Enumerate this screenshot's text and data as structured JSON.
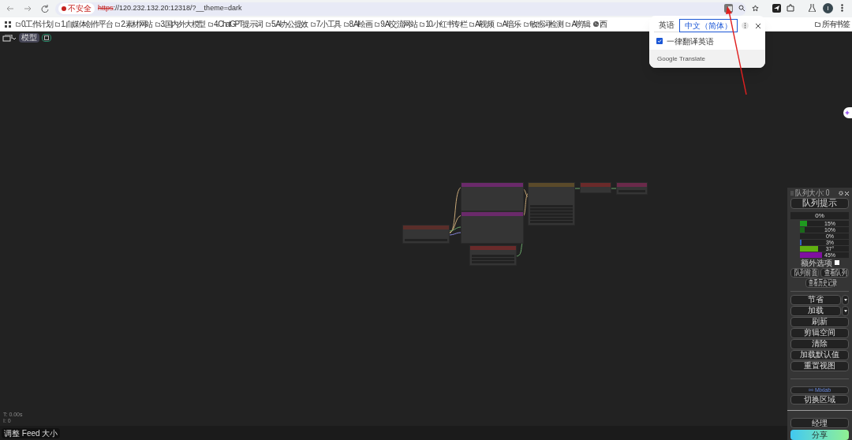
{
  "browser": {
    "address": {
      "security": "不安全",
      "scheme": "https",
      "rest": "://120.232.132.20:12318/?__theme=dark"
    },
    "bookmarks": [
      {
        "label": "0.工作计划",
        "kind": "folder"
      },
      {
        "label": "1.自媒体创作平台",
        "kind": "folder"
      },
      {
        "label": "2.素材网站",
        "kind": "folder"
      },
      {
        "label": "3.国内外大模型",
        "kind": "folder"
      },
      {
        "label": "4.ChatGPT提示词",
        "kind": "folder"
      },
      {
        "label": "5.AI办公提效",
        "kind": "folder"
      },
      {
        "label": "7.小工具",
        "kind": "folder"
      },
      {
        "label": "8.AI绘画",
        "kind": "folder"
      },
      {
        "label": "9.AI交流网站",
        "kind": "folder"
      },
      {
        "label": "10.小红书专栏",
        "kind": "folder"
      },
      {
        "label": "AI视频",
        "kind": "folder"
      },
      {
        "label": "AI音乐",
        "kind": "folder"
      },
      {
        "label": "敏感词检测",
        "kind": "folder"
      },
      {
        "label": "AI剪辑",
        "kind": "folder"
      },
      {
        "label": "西",
        "kind": "globe"
      }
    ],
    "all_bookmarks": "所有书签",
    "profile_initial": "I"
  },
  "translate_popup": {
    "tabs": [
      {
        "label": "英语",
        "selected": false
      },
      {
        "label": "中文（简体）",
        "selected": true
      }
    ],
    "always_translate": {
      "label": "一律翻译英语",
      "checked": true
    },
    "footer": "Google Translate"
  },
  "toolbar": {
    "models_button": "模型"
  },
  "graph": {
    "nodes": [
      {
        "color": "#6a2a6a"
      },
      {
        "color": "#6a2a6a"
      },
      {
        "color": "#5a4a2a"
      },
      {
        "color": "#6a2a2a"
      },
      {
        "color": "#6a2a4a"
      },
      {
        "color": "#5a2e2a"
      },
      {
        "color": "#6a2a2a"
      }
    ]
  },
  "queue": {
    "size_label": "队列大小: 0",
    "prompt_button": "队列提示",
    "progress": {
      "text": "0%",
      "level": 0
    },
    "monitors": [
      {
        "reading": "15%",
        "level": 0.15,
        "color": "#1f9a1f"
      },
      {
        "reading": "10%",
        "level": 0.1,
        "color": "#1a6a1a"
      },
      {
        "reading": "0%"
      },
      {
        "reading": "3%",
        "level": 0.03,
        "color": "#3060c0"
      },
      {
        "reading": "37°",
        "level": 0.37,
        "color": "#60b010"
      },
      {
        "reading": "45%",
        "level": 0.45,
        "color": "#8010a0"
      }
    ],
    "extra_options": {
      "label": "额外选项",
      "checked": false
    },
    "small_buttons": [
      "队列前面",
      "查看队列"
    ],
    "history_button": "查看历史记录",
    "actions": [
      {
        "label": "节省",
        "dropdown": true
      },
      {
        "label": "加载",
        "dropdown": true
      },
      {
        "label": "刷新",
        "dropdown": false
      },
      {
        "label": "剪辑空间",
        "dropdown": false
      },
      {
        "label": "清除",
        "dropdown": false
      },
      {
        "label": "加载默认值",
        "dropdown": false
      },
      {
        "label": "重置视图",
        "dropdown": false
      }
    ],
    "mixlab": "Mixlab",
    "switch_button": "切换区域",
    "manager_button": "经理",
    "share_button": "分享"
  },
  "stats": {
    "time": "T: 0.00s",
    "items": "I: 0"
  },
  "feed_button": "调整 Feed 大小"
}
